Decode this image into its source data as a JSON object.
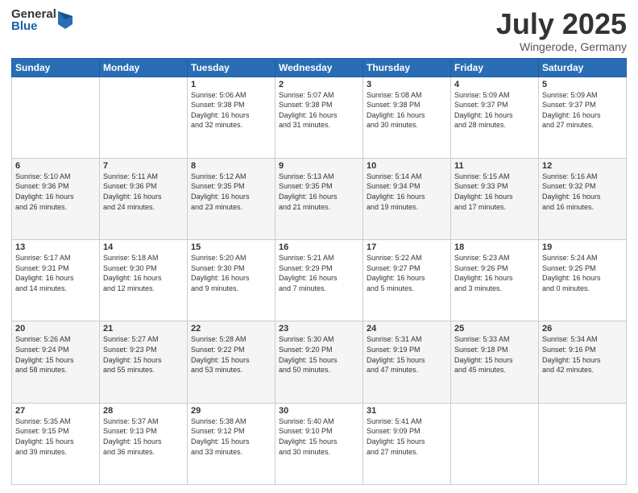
{
  "logo": {
    "general": "General",
    "blue": "Blue"
  },
  "title": "July 2025",
  "location": "Wingerode, Germany",
  "weekdays": [
    "Sunday",
    "Monday",
    "Tuesday",
    "Wednesday",
    "Thursday",
    "Friday",
    "Saturday"
  ],
  "weeks": [
    [
      {
        "day": "",
        "info": ""
      },
      {
        "day": "",
        "info": ""
      },
      {
        "day": "1",
        "info": "Sunrise: 5:06 AM\nSunset: 9:38 PM\nDaylight: 16 hours\nand 32 minutes."
      },
      {
        "day": "2",
        "info": "Sunrise: 5:07 AM\nSunset: 9:38 PM\nDaylight: 16 hours\nand 31 minutes."
      },
      {
        "day": "3",
        "info": "Sunrise: 5:08 AM\nSunset: 9:38 PM\nDaylight: 16 hours\nand 30 minutes."
      },
      {
        "day": "4",
        "info": "Sunrise: 5:09 AM\nSunset: 9:37 PM\nDaylight: 16 hours\nand 28 minutes."
      },
      {
        "day": "5",
        "info": "Sunrise: 5:09 AM\nSunset: 9:37 PM\nDaylight: 16 hours\nand 27 minutes."
      }
    ],
    [
      {
        "day": "6",
        "info": "Sunrise: 5:10 AM\nSunset: 9:36 PM\nDaylight: 16 hours\nand 26 minutes."
      },
      {
        "day": "7",
        "info": "Sunrise: 5:11 AM\nSunset: 9:36 PM\nDaylight: 16 hours\nand 24 minutes."
      },
      {
        "day": "8",
        "info": "Sunrise: 5:12 AM\nSunset: 9:35 PM\nDaylight: 16 hours\nand 23 minutes."
      },
      {
        "day": "9",
        "info": "Sunrise: 5:13 AM\nSunset: 9:35 PM\nDaylight: 16 hours\nand 21 minutes."
      },
      {
        "day": "10",
        "info": "Sunrise: 5:14 AM\nSunset: 9:34 PM\nDaylight: 16 hours\nand 19 minutes."
      },
      {
        "day": "11",
        "info": "Sunrise: 5:15 AM\nSunset: 9:33 PM\nDaylight: 16 hours\nand 17 minutes."
      },
      {
        "day": "12",
        "info": "Sunrise: 5:16 AM\nSunset: 9:32 PM\nDaylight: 16 hours\nand 16 minutes."
      }
    ],
    [
      {
        "day": "13",
        "info": "Sunrise: 5:17 AM\nSunset: 9:31 PM\nDaylight: 16 hours\nand 14 minutes."
      },
      {
        "day": "14",
        "info": "Sunrise: 5:18 AM\nSunset: 9:30 PM\nDaylight: 16 hours\nand 12 minutes."
      },
      {
        "day": "15",
        "info": "Sunrise: 5:20 AM\nSunset: 9:30 PM\nDaylight: 16 hours\nand 9 minutes."
      },
      {
        "day": "16",
        "info": "Sunrise: 5:21 AM\nSunset: 9:29 PM\nDaylight: 16 hours\nand 7 minutes."
      },
      {
        "day": "17",
        "info": "Sunrise: 5:22 AM\nSunset: 9:27 PM\nDaylight: 16 hours\nand 5 minutes."
      },
      {
        "day": "18",
        "info": "Sunrise: 5:23 AM\nSunset: 9:26 PM\nDaylight: 16 hours\nand 3 minutes."
      },
      {
        "day": "19",
        "info": "Sunrise: 5:24 AM\nSunset: 9:25 PM\nDaylight: 16 hours\nand 0 minutes."
      }
    ],
    [
      {
        "day": "20",
        "info": "Sunrise: 5:26 AM\nSunset: 9:24 PM\nDaylight: 15 hours\nand 58 minutes."
      },
      {
        "day": "21",
        "info": "Sunrise: 5:27 AM\nSunset: 9:23 PM\nDaylight: 15 hours\nand 55 minutes."
      },
      {
        "day": "22",
        "info": "Sunrise: 5:28 AM\nSunset: 9:22 PM\nDaylight: 15 hours\nand 53 minutes."
      },
      {
        "day": "23",
        "info": "Sunrise: 5:30 AM\nSunset: 9:20 PM\nDaylight: 15 hours\nand 50 minutes."
      },
      {
        "day": "24",
        "info": "Sunrise: 5:31 AM\nSunset: 9:19 PM\nDaylight: 15 hours\nand 47 minutes."
      },
      {
        "day": "25",
        "info": "Sunrise: 5:33 AM\nSunset: 9:18 PM\nDaylight: 15 hours\nand 45 minutes."
      },
      {
        "day": "26",
        "info": "Sunrise: 5:34 AM\nSunset: 9:16 PM\nDaylight: 15 hours\nand 42 minutes."
      }
    ],
    [
      {
        "day": "27",
        "info": "Sunrise: 5:35 AM\nSunset: 9:15 PM\nDaylight: 15 hours\nand 39 minutes."
      },
      {
        "day": "28",
        "info": "Sunrise: 5:37 AM\nSunset: 9:13 PM\nDaylight: 15 hours\nand 36 minutes."
      },
      {
        "day": "29",
        "info": "Sunrise: 5:38 AM\nSunset: 9:12 PM\nDaylight: 15 hours\nand 33 minutes."
      },
      {
        "day": "30",
        "info": "Sunrise: 5:40 AM\nSunset: 9:10 PM\nDaylight: 15 hours\nand 30 minutes."
      },
      {
        "day": "31",
        "info": "Sunrise: 5:41 AM\nSunset: 9:09 PM\nDaylight: 15 hours\nand 27 minutes."
      },
      {
        "day": "",
        "info": ""
      },
      {
        "day": "",
        "info": ""
      }
    ]
  ]
}
